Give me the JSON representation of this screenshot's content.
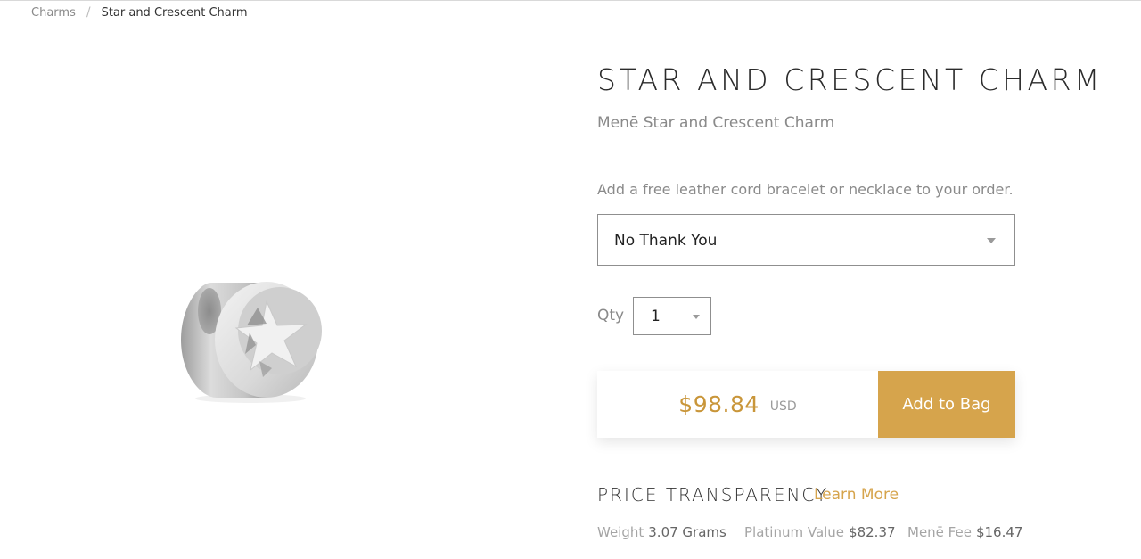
{
  "breadcrumb": {
    "parent": "Charms",
    "separator": "/",
    "current": "Star and Crescent Charm"
  },
  "product": {
    "title": "STAR AND CRESCENT CHARM",
    "subtitle": "Menē Star and Crescent Charm",
    "image_icon": "star-and-crescent-charm-image"
  },
  "cord_option": {
    "label": "Add a free leather cord bracelet or necklace to your order.",
    "selected": "No Thank You"
  },
  "quantity": {
    "label": "Qty",
    "selected": "1"
  },
  "purchase": {
    "price": "$98.84",
    "currency": "USD",
    "add_button": "Add to Bag",
    "price_color": "#c9963a",
    "button_color": "#d6a44c"
  },
  "transparency": {
    "heading": "PRICE TRANSPARENCY",
    "learn_more": "Learn More",
    "weight_label": "Weight",
    "weight_value": "3.07 Grams",
    "platinum_label": "Platinum Value",
    "platinum_value": "$82.37",
    "fee_label": "Menē Fee",
    "fee_value": "$16.47"
  }
}
